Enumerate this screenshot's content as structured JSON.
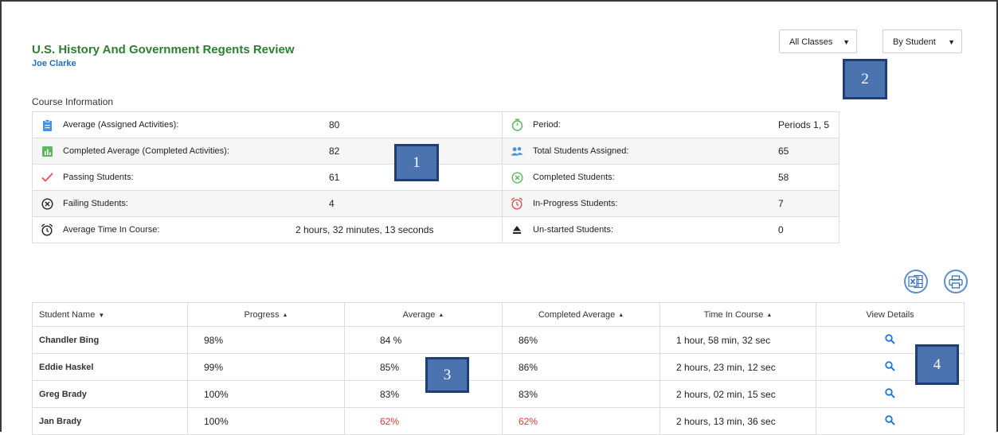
{
  "header": {
    "title": "U.S. History And Government Regents Review",
    "teacher": "Joe Clarke"
  },
  "filters": {
    "classes": "All Classes",
    "view": "By Student"
  },
  "callouts": [
    "1",
    "2",
    "3",
    "4"
  ],
  "course_info": {
    "label": "Course Information",
    "rows": [
      {
        "left": {
          "icon": "clipboard-icon",
          "label": "Average (Assigned Activities):",
          "value": "80"
        },
        "right": {
          "icon": "stopwatch-icon",
          "label": "Period:",
          "value": "Periods 1, 5"
        }
      },
      {
        "left": {
          "icon": "bar-chart-icon",
          "label": "Completed Average (Completed Activities):",
          "value": "82"
        },
        "right": {
          "icon": "people-icon",
          "label": "Total Students Assigned:",
          "value": "65"
        }
      },
      {
        "left": {
          "icon": "checkmark-icon",
          "label": "Passing Students:",
          "value": "61"
        },
        "right": {
          "icon": "circle-x-icon",
          "label": "Completed Students:",
          "value": "58"
        }
      },
      {
        "left": {
          "icon": "circle-x-icon",
          "label": "Failing Students:",
          "value": "4"
        },
        "right": {
          "icon": "alarm-clock-icon",
          "label": "In-Progress Students:",
          "value": "7"
        }
      },
      {
        "left": {
          "icon": "alarm-clock-icon",
          "label": "Average Time In Course:",
          "value": "2 hours, 32 minutes, 13 seconds"
        },
        "right": {
          "icon": "eject-icon",
          "label": "Un-started Students:",
          "value": "0"
        }
      }
    ]
  },
  "colors": {
    "title_green": "#2e7d32",
    "link_blue": "#1f6fb5",
    "icon_blue": "#4a8fd8",
    "icon_green": "#5cb85c",
    "check_red": "#e0524f",
    "failing_red": "#e53935",
    "callout_bg": "#4a73b0"
  },
  "table": {
    "columns": [
      "Student Name",
      "Progress",
      "Average",
      "Completed Average",
      "Time In Course",
      "View Details"
    ],
    "rows": [
      {
        "name": "Chandler Bing",
        "progress": "98%",
        "average": "84 %",
        "completed": "86%",
        "time": "1 hour, 58 min, 32 sec",
        "low": false
      },
      {
        "name": "Eddie Haskel",
        "progress": "99%",
        "average": "85%",
        "completed": "86%",
        "time": "2 hours, 23 min, 12 sec",
        "low": false
      },
      {
        "name": "Greg Brady",
        "progress": "100%",
        "average": "83%",
        "completed": "83%",
        "time": "2 hours, 02 min, 15 sec",
        "low": false
      },
      {
        "name": "Jan Brady",
        "progress": "100%",
        "average": "62%",
        "completed": "62%",
        "time": "2 hours, 13 min, 36 sec",
        "low": true
      }
    ]
  }
}
